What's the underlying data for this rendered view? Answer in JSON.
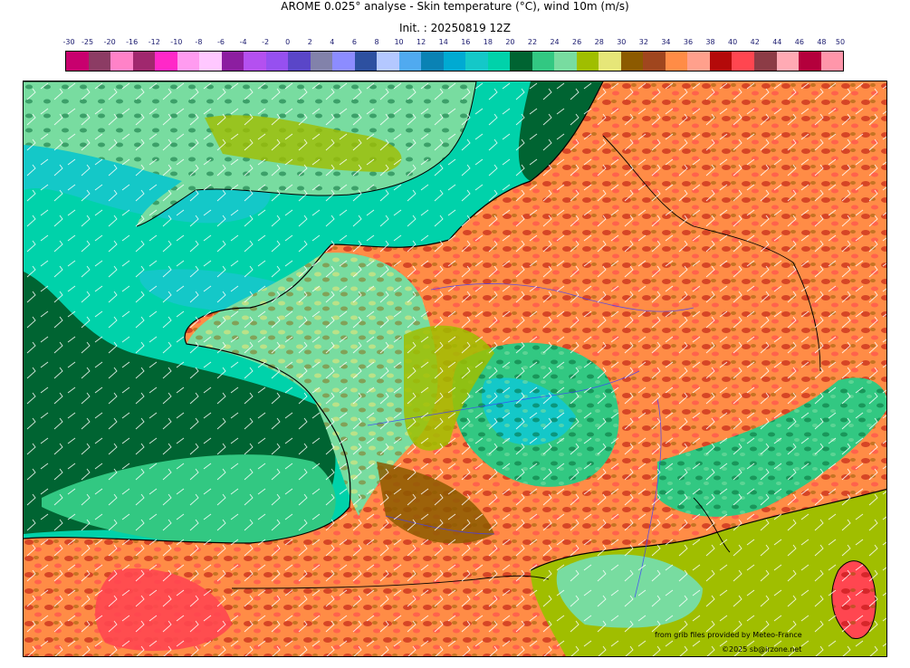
{
  "header": {
    "title": "AROME 0.025° analyse - Skin temperature (°C), wind 10m (m/s)",
    "init": "Init. : 20250819 12Z"
  },
  "colorbar": {
    "ticks": [
      "-30",
      "-25",
      "-20",
      "-16",
      "-12",
      "-10",
      "-8",
      "-6",
      "-4",
      "-2",
      "0",
      "2",
      "4",
      "6",
      "8",
      "10",
      "12",
      "14",
      "16",
      "18",
      "20",
      "22",
      "24",
      "26",
      "28",
      "30",
      "32",
      "34",
      "36",
      "38",
      "40",
      "42",
      "44",
      "46",
      "48",
      "50"
    ],
    "colors": [
      "#c8006e",
      "#8c3c64",
      "#ff82c8",
      "#a0286e",
      "#ff28c8",
      "#ff9bf0",
      "#ffc8ff",
      "#8c1ea0",
      "#b450f0",
      "#9650f0",
      "#5a46c8",
      "#8282aa",
      "#8c8cff",
      "#2d50a0",
      "#b4c8ff",
      "#50aaf0",
      "#0a82b4",
      "#00aad2",
      "#14c8c8",
      "#00d2aa",
      "#006432",
      "#32c882",
      "#78dca0",
      "#a0be00",
      "#e6e678",
      "#8c5a00",
      "#a0461e",
      "#ff8c46",
      "#ffa08c",
      "#b40a0a",
      "#ff4650",
      "#8c3c46",
      "#ffaab4",
      "#b4003c",
      "#ff96aa"
    ]
  },
  "map": {
    "legend_colors": {
      "sea_cold": "#00d2aa",
      "sea_mid": "#32c882",
      "sea_dark": "#006432",
      "sea_cool": "#14c8c8",
      "land_mild": "#a0be00",
      "land_warm": "#8c5a00",
      "land_hot": "#ff8c46",
      "land_very_hot": "#ff4650",
      "border": "#000000",
      "rivers": "#3c3cff"
    }
  },
  "credits": {
    "source": "from grib files provided by Meteo-France",
    "copyright": "©2025 sb@irzone.net"
  }
}
